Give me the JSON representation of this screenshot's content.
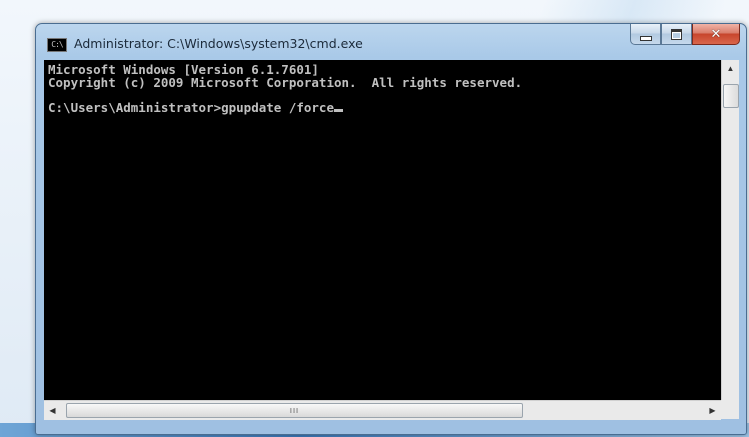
{
  "window": {
    "title": "Administrator: C:\\Windows\\system32\\cmd.exe",
    "icon_text": "C:\\",
    "buttons": {
      "minimize": "minimize",
      "maximize": "maximize",
      "close": "✕"
    }
  },
  "console": {
    "lines": [
      "Microsoft Windows [Version 6.1.7601]",
      "Copyright (c) 2009 Microsoft Corporation.  All rights reserved.",
      "",
      "C:\\Users\\Administrator>gpupdate /force"
    ]
  },
  "scrollbars": {
    "up_arrow": "▲",
    "down_arrow": "▼",
    "left_arrow": "◀",
    "right_arrow": "▶",
    "grip": "III"
  }
}
